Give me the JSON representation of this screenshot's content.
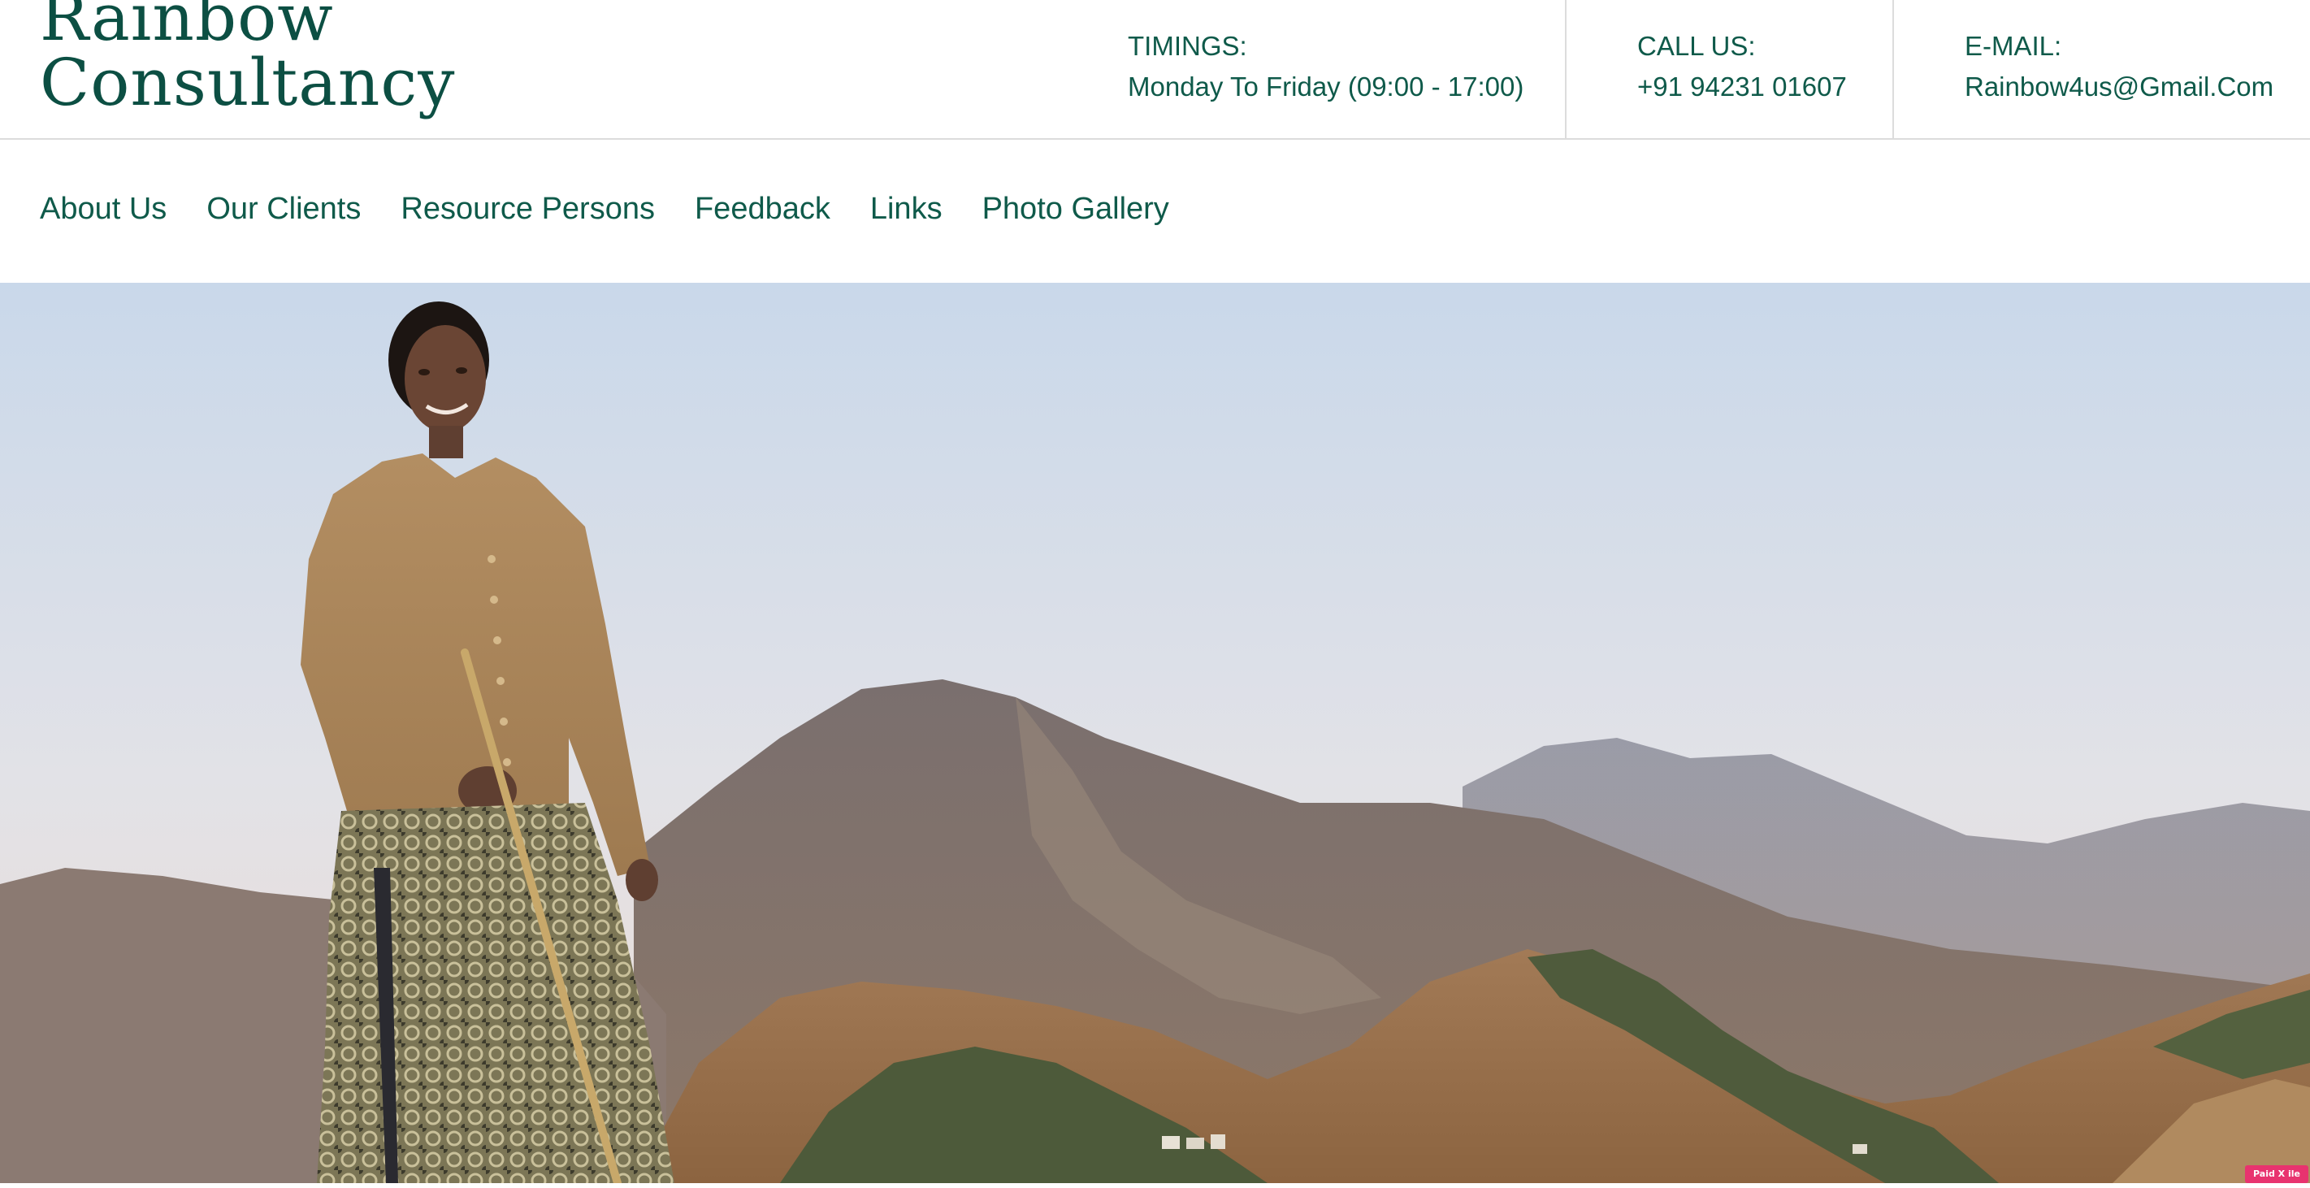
{
  "brand": {
    "line1": "Rainbow",
    "line2": "Consultancy",
    "color": "#0c4f43"
  },
  "contact": {
    "timings": {
      "label": "TIMINGS:",
      "value": "Monday To Friday (09:00 - 17:00)"
    },
    "call": {
      "label": "CALL US:",
      "value": "+91 94231 01607"
    },
    "email": {
      "label": "E-MAIL:",
      "value": "Rainbow4us@Gmail.Com"
    }
  },
  "nav": {
    "items": [
      {
        "label": "About Us"
      },
      {
        "label": "Our Clients"
      },
      {
        "label": "Resource Persons"
      },
      {
        "label": "Feedback"
      },
      {
        "label": "Links"
      },
      {
        "label": "Photo Gallery"
      }
    ]
  },
  "hero": {
    "image": "photo-woman-on-mountain-ridge"
  },
  "badge": {
    "label": "Paid X ile"
  },
  "colors": {
    "accent": "#0f5a4a",
    "divider": "#dcdcdc",
    "sky_top": "#c7d7e8",
    "sky_bottom": "#e9e5e4"
  }
}
